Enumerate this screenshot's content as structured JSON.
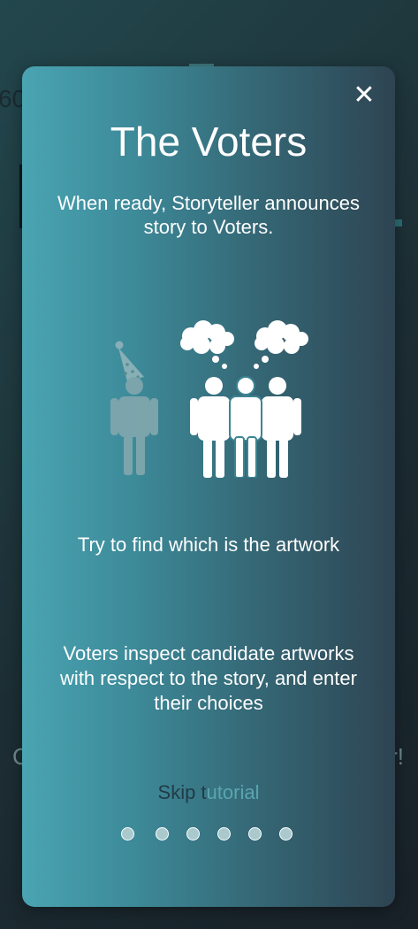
{
  "background": {
    "timer_text": "60",
    "left_text": "C",
    "right_text": "r!"
  },
  "modal": {
    "close_icon": "close-icon",
    "close_label": "✕",
    "title": "The Voters",
    "subtitle": "When ready, Storyteller announces story to Voters.",
    "heading": "Try to find which is the artwork",
    "description": "Voters inspect candidate artworks with respect to the story, and enter their choices",
    "skip_label_main": "Skip t",
    "skip_label_faded": "utorial",
    "pagination": {
      "count": 6,
      "current_index": 1
    }
  },
  "colors": {
    "modal_gradient_start": "#4aa4b2",
    "modal_gradient_end": "#2e4452",
    "text": "#ffffff",
    "dot_fill": "#a9c9cd"
  }
}
